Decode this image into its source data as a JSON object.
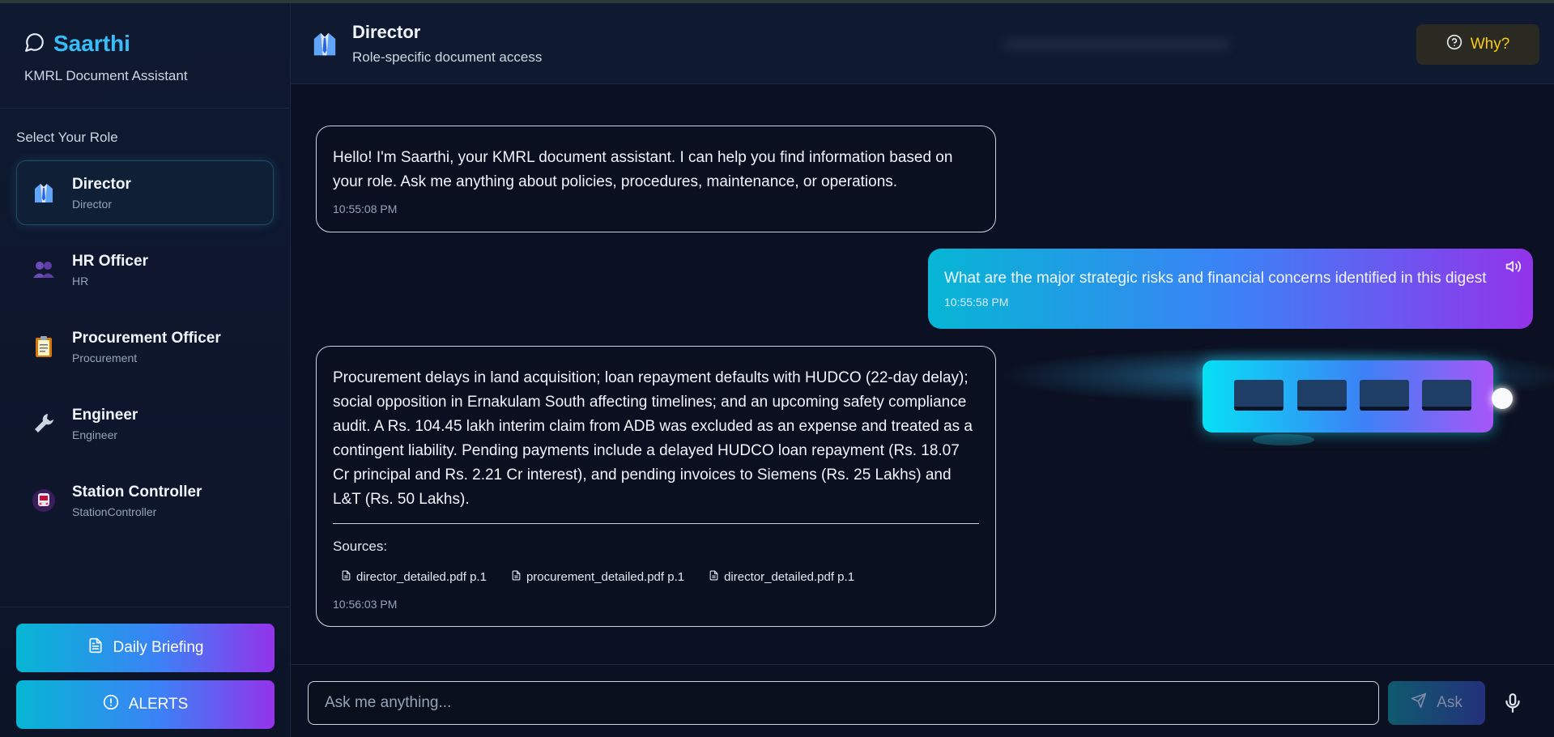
{
  "app": {
    "name": "Saarthi",
    "subtitle": "KMRL Document Assistant"
  },
  "sidebar": {
    "heading": "Select Your Role",
    "roles": [
      {
        "name": "Director",
        "sub": "Director",
        "icon": "director-icon",
        "active": true
      },
      {
        "name": "HR Officer",
        "sub": "HR",
        "icon": "people-icon"
      },
      {
        "name": "Procurement Officer",
        "sub": "Procurement",
        "icon": "clipboard-icon"
      },
      {
        "name": "Engineer",
        "sub": "Engineer",
        "icon": "wrench-icon"
      },
      {
        "name": "Station Controller",
        "sub": "StationController",
        "icon": "train-icon"
      }
    ],
    "daily_briefing": "Daily Briefing",
    "alerts": "ALERTS"
  },
  "header": {
    "title": "Director",
    "subtitle": "Role-specific document access",
    "why_label": "Why?"
  },
  "messages": [
    {
      "from": "bot",
      "text": "Hello! I'm Saarthi, your KMRL document assistant. I can help you find information based on your role. Ask me anything about policies, procedures, maintenance, or operations.",
      "time": "10:55:08 PM"
    },
    {
      "from": "user",
      "text": "What are the major strategic risks and financial concerns identified in this digest",
      "time": "10:55:58 PM"
    },
    {
      "from": "bot",
      "text": "Procurement delays in land acquisition; loan repayment defaults with HUDCO (22-day delay); social opposition in Ernakulam South affecting timelines; and an upcoming safety compliance audit.  A Rs. 104.45 lakh interim claim from ADB was excluded as an expense and treated as a contingent liability.  Pending payments include a delayed HUDCO loan repayment (Rs. 18.07 Cr principal and Rs. 2.21 Cr interest), and pending invoices to Siemens (Rs. 25 Lakhs) and L&T (Rs. 50 Lakhs).",
      "sources_label": "Sources:",
      "sources": [
        "director_detailed.pdf p.1",
        "procurement_detailed.pdf p.1",
        "director_detailed.pdf p.1"
      ],
      "time": "10:56:03 PM"
    }
  ],
  "input": {
    "placeholder": "Ask me anything...",
    "value": "",
    "ask_label": "Ask"
  },
  "colors": {
    "brand": "#38bdf8",
    "gradient_start": "#06b6d4",
    "gradient_end": "#9333ea",
    "why": "#facc15"
  }
}
